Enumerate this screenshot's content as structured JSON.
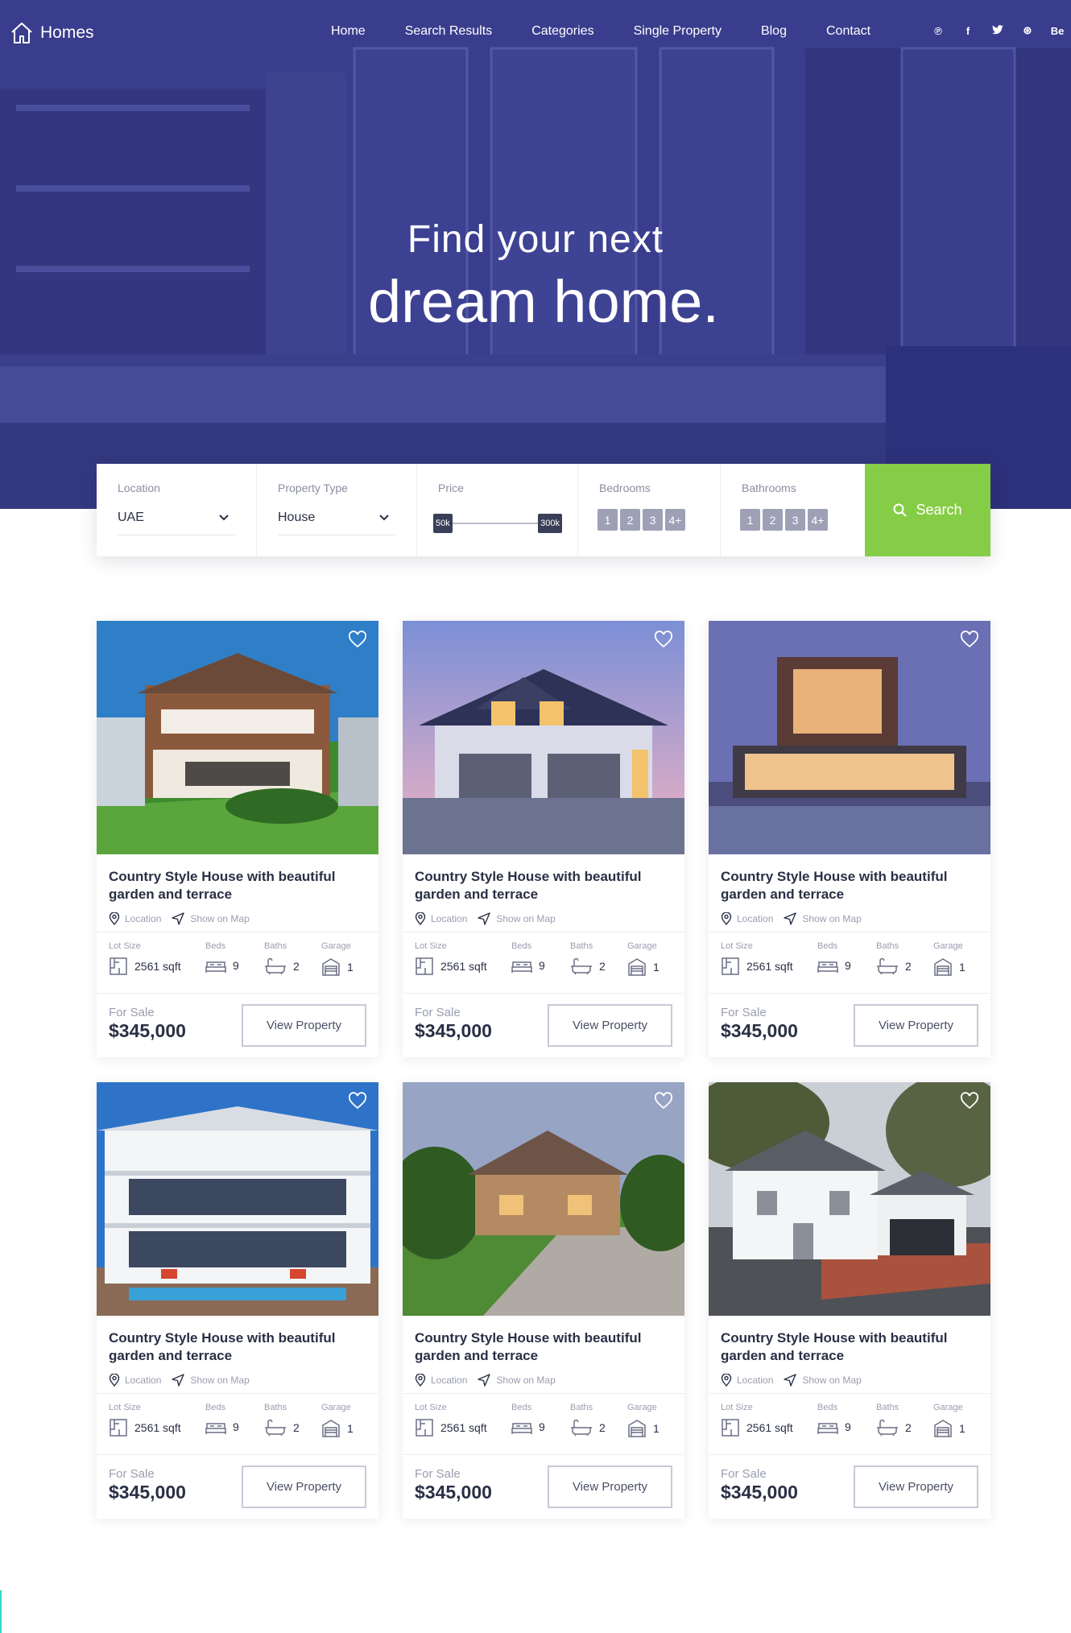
{
  "brand": {
    "name": "Homes"
  },
  "nav": {
    "items": [
      "Home",
      "Search Results",
      "Categories",
      "Single Property",
      "Blog",
      "Contact"
    ]
  },
  "social": [
    {
      "icon": "pinterest-icon",
      "glyph": "℗"
    },
    {
      "icon": "facebook-icon",
      "glyph": "f"
    },
    {
      "icon": "twitter-icon",
      "glyph": "🐦"
    },
    {
      "icon": "dribbble-icon",
      "glyph": "⊛"
    },
    {
      "icon": "behance-icon",
      "glyph": "Be"
    }
  ],
  "hero": {
    "line1": "Find your next",
    "line2": "dream home."
  },
  "search": {
    "location_label": "Location",
    "location_value": "UAE",
    "type_label": "Property Type",
    "type_value": "House",
    "price_label": "Price",
    "price_min": "50k",
    "price_max": "300k",
    "bedrooms_label": "Bedrooms",
    "bathrooms_label": "Bathrooms",
    "count_options": [
      "1",
      "2",
      "3",
      "4+"
    ],
    "button_label": "Search"
  },
  "colors": {
    "accent": "#86cd47",
    "hero_overlay": "#3b3f8f"
  },
  "listings": [
    {
      "title": "Country Style House with beautiful garden and terrace",
      "location": "Location",
      "map": "Show on Map",
      "lot_label": "Lot Size",
      "lot": "2561 sqft",
      "beds_label": "Beds",
      "beds": "9",
      "baths_label": "Baths",
      "baths": "2",
      "garage_label": "Garage",
      "garage": "1",
      "status": "For Sale",
      "price": "$345,000",
      "button": "View Property"
    },
    {
      "title": "Country Style House with beautiful garden and terrace",
      "location": "Location",
      "map": "Show on Map",
      "lot_label": "Lot Size",
      "lot": "2561 sqft",
      "beds_label": "Beds",
      "beds": "9",
      "baths_label": "Baths",
      "baths": "2",
      "garage_label": "Garage",
      "garage": "1",
      "status": "For Sale",
      "price": "$345,000",
      "button": "View Property"
    },
    {
      "title": "Country Style House with beautiful garden and terrace",
      "location": "Location",
      "map": "Show on Map",
      "lot_label": "Lot Size",
      "lot": "2561 sqft",
      "beds_label": "Beds",
      "beds": "9",
      "baths_label": "Baths",
      "baths": "2",
      "garage_label": "Garage",
      "garage": "1",
      "status": "For Sale",
      "price": "$345,000",
      "button": "View Property"
    },
    {
      "title": "Country Style House with beautiful garden and terrace",
      "location": "Location",
      "map": "Show on Map",
      "lot_label": "Lot Size",
      "lot": "2561 sqft",
      "beds_label": "Beds",
      "beds": "9",
      "baths_label": "Baths",
      "baths": "2",
      "garage_label": "Garage",
      "garage": "1",
      "status": "For Sale",
      "price": "$345,000",
      "button": "View Property"
    },
    {
      "title": "Country Style House with beautiful garden and terrace",
      "location": "Location",
      "map": "Show on Map",
      "lot_label": "Lot Size",
      "lot": "2561 sqft",
      "beds_label": "Beds",
      "beds": "9",
      "baths_label": "Baths",
      "baths": "2",
      "garage_label": "Garage",
      "garage": "1",
      "status": "For Sale",
      "price": "$345,000",
      "button": "View Property"
    },
    {
      "title": "Country Style House with beautiful garden and terrace",
      "location": "Location",
      "map": "Show on Map",
      "lot_label": "Lot Size",
      "lot": "2561 sqft",
      "beds_label": "Beds",
      "beds": "9",
      "baths_label": "Baths",
      "baths": "2",
      "garage_label": "Garage",
      "garage": "1",
      "status": "For Sale",
      "price": "$345,000",
      "button": "View Property"
    }
  ]
}
